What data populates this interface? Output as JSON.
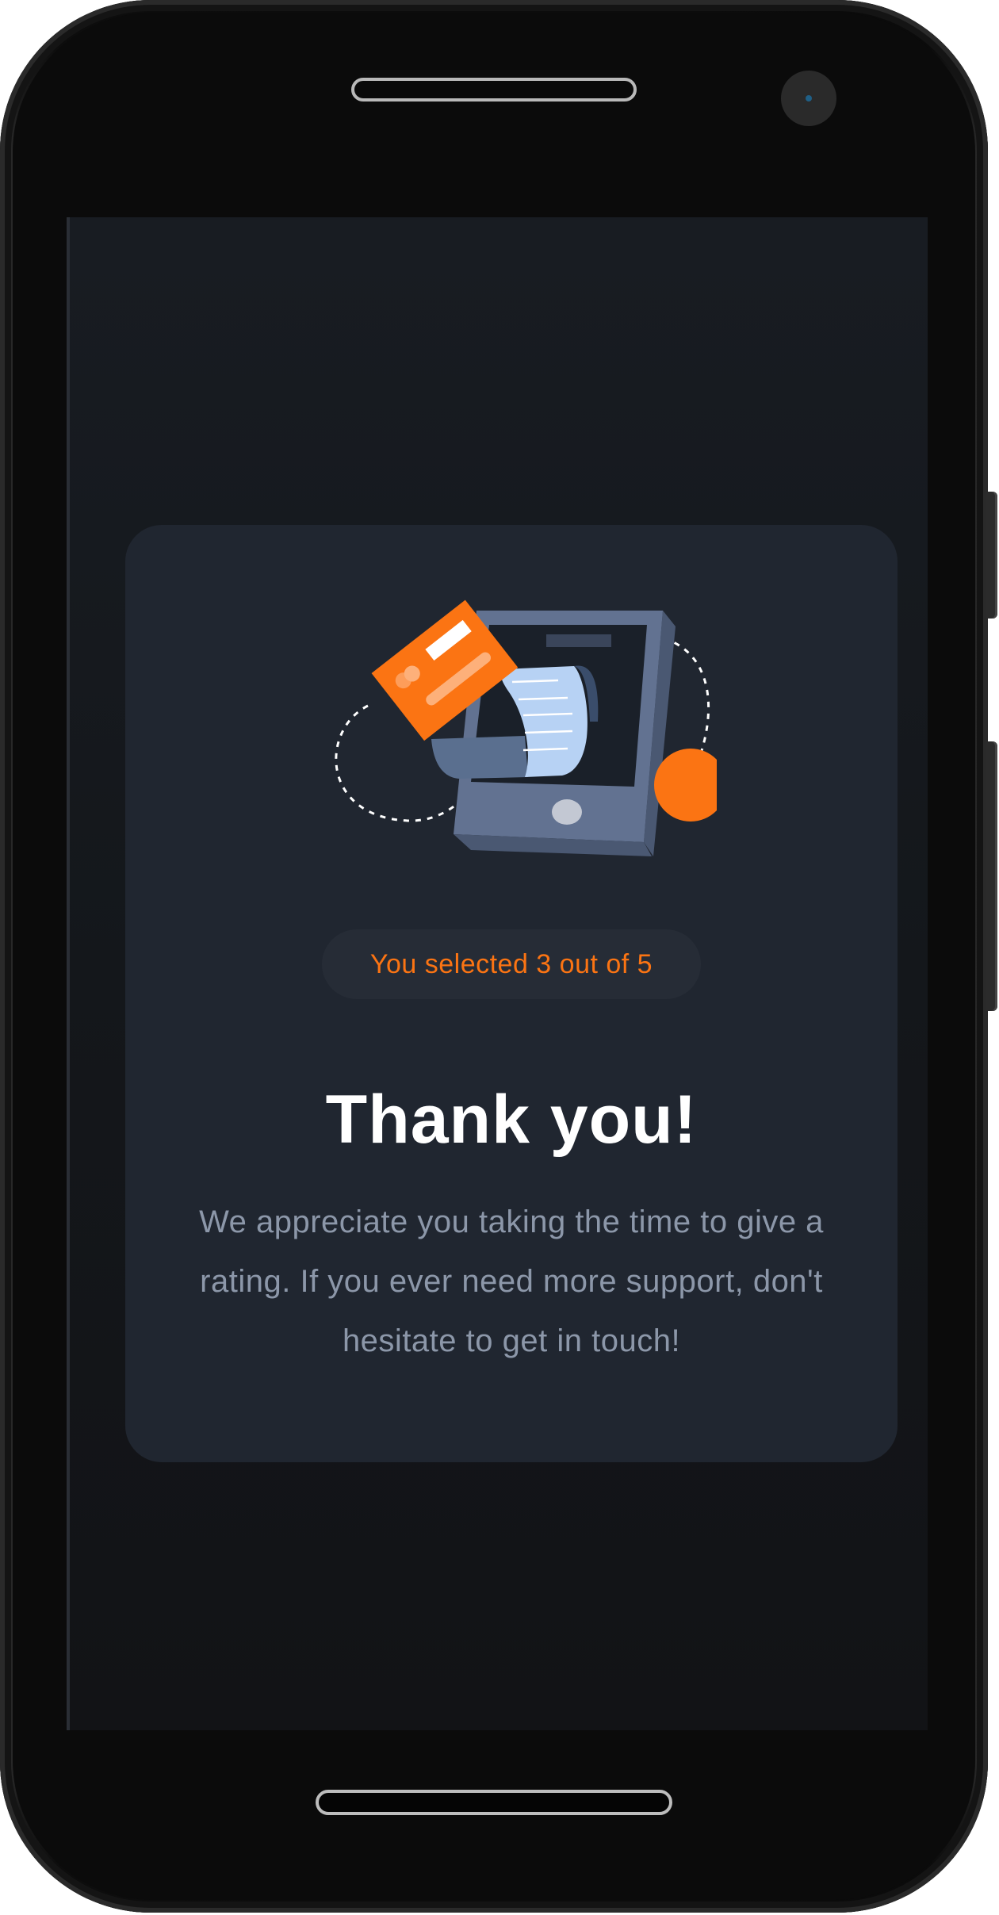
{
  "rating": {
    "selected": 3,
    "max": 5,
    "selection_text": "You selected 3 out of 5"
  },
  "thank_you": {
    "title": "Thank you!",
    "message": "We appreciate you taking the time to give a rating. If you ever need more support, don't hesitate to get in touch!"
  },
  "colors": {
    "accent": "#fb7413",
    "card_background": "#202630",
    "screen_background": "#14171b",
    "message_text": "#8c97a9",
    "title_text": "#ffffff"
  },
  "icons": {
    "illustration": "payment-receipt-illustration"
  }
}
